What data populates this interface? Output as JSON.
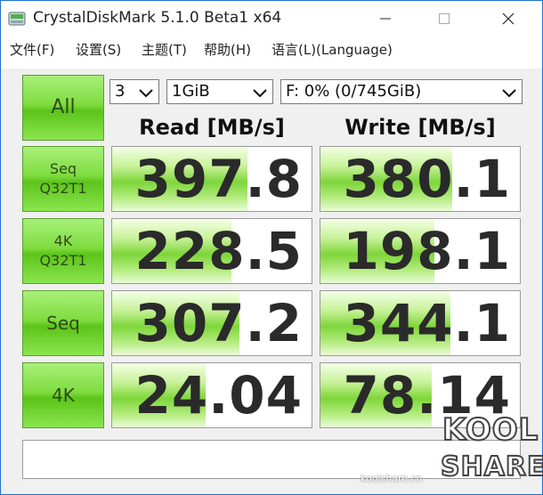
{
  "window": {
    "title": "CrystalDiskMark 5.1.0 Beta1 x64"
  },
  "menu": [
    {
      "label": "文件(F)"
    },
    {
      "label": "设置(S)"
    },
    {
      "label": "主题(T)"
    },
    {
      "label": "帮助(H)"
    },
    {
      "label": "语言(L)(Language)"
    }
  ],
  "controls": {
    "all_label": "All",
    "count": "3",
    "size": "1GiB",
    "drive": "F: 0% (0/745GiB)"
  },
  "columns": {
    "read": "Read [MB/s]",
    "write": "Write [MB/s]"
  },
  "rows": [
    {
      "label1": "Seq",
      "label2": "Q32T1",
      "read": "397.8",
      "write": "380.1",
      "read_fill": 0.68,
      "write_fill": 0.66
    },
    {
      "label1": "4K",
      "label2": "Q32T1",
      "read": "228.5",
      "write": "198.1",
      "read_fill": 0.6,
      "write_fill": 0.57
    },
    {
      "label1": "Seq",
      "label2": "",
      "read": "307.2",
      "write": "344.1",
      "read_fill": 0.64,
      "write_fill": 0.65
    },
    {
      "label1": "4K",
      "label2": "",
      "read": "24.04",
      "write": "78.14",
      "read_fill": 0.47,
      "write_fill": 0.56
    }
  ],
  "watermark": {
    "site": "koolshare.cn",
    "brand_top": "KOOL",
    "brand_bottom": "SHARE"
  },
  "colors": {
    "accent_green": "#5cc41a",
    "window_border": "#1f6fd1",
    "panel_bg": "#f0f0f0"
  }
}
